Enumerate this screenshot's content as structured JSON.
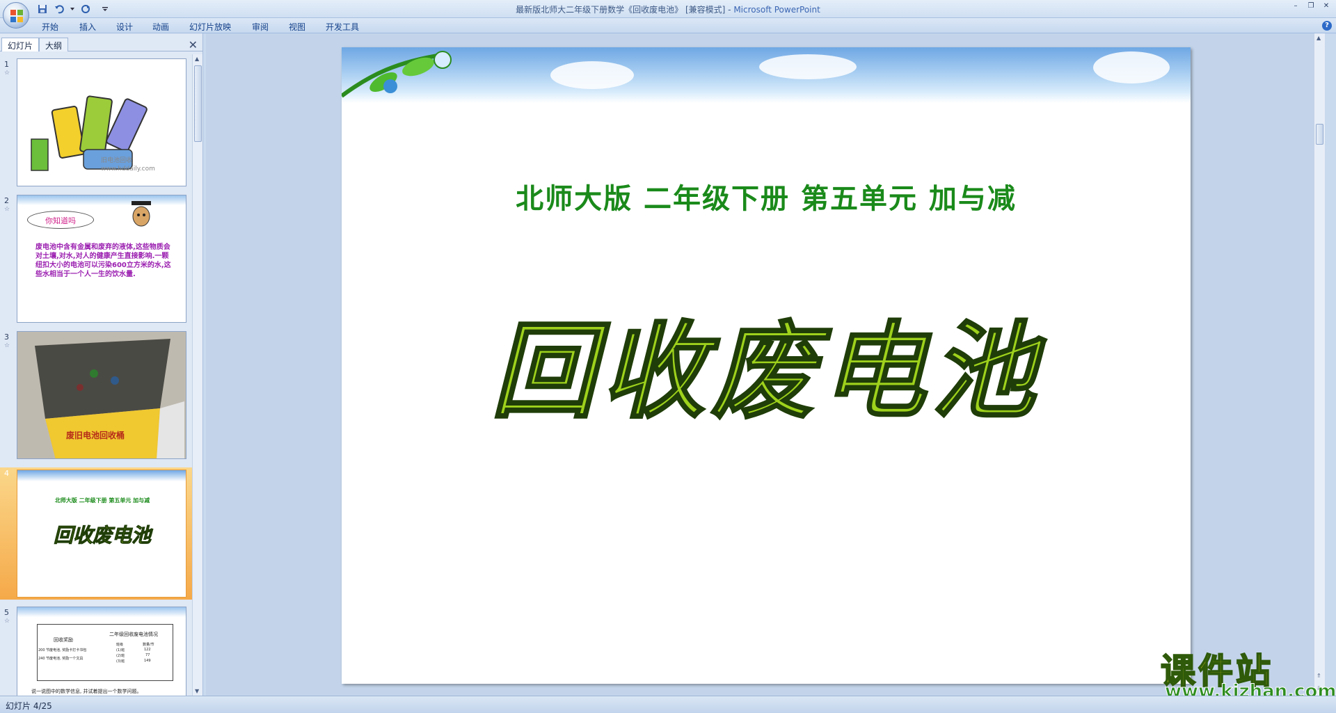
{
  "window": {
    "title": "最新版北师大二年级下册数学《回收废电池》 [兼容模式] - ",
    "app_name": "Microsoft PowerPoint"
  },
  "ribbon": {
    "tabs": [
      {
        "label": "开始"
      },
      {
        "label": "插入"
      },
      {
        "label": "设计"
      },
      {
        "label": "动画"
      },
      {
        "label": "幻灯片放映"
      },
      {
        "label": "审阅"
      },
      {
        "label": "视图"
      },
      {
        "label": "开发工具"
      }
    ]
  },
  "left_pane": {
    "tabs": [
      {
        "label": "幻灯片"
      },
      {
        "label": "大纲"
      }
    ],
    "slides": [
      {
        "number": "1",
        "text": "旧电池回收 www.hddaily.com"
      },
      {
        "number": "2",
        "bubble": "你知道吗",
        "text": "废电池中含有金属和废弃的液体,这些物质会对土壤,对水,对人的健康产生直接影响.一颗纽扣大小的电池可以污染600立方米的水,这些水相当于一个人一生的饮水量."
      },
      {
        "number": "3",
        "text": "废旧电池回收桶"
      },
      {
        "number": "4",
        "subtitle": "北师大版 二年级下册 第五单元 加与减",
        "title": "回收废电池"
      },
      {
        "number": "5",
        "table_title_left": "回收奖励",
        "table_title_right": "二年级回收废电池情况",
        "row1": "200 节废电池, 奖励卡打卡书包",
        "row2": "240 节废电池, 奖励一个文具",
        "hdr1": "班级",
        "hdr2": "数量/节",
        "c1": "(1)班",
        "v1": "122",
        "c2": "(2)班",
        "v2": "77",
        "c3": "(3)班",
        "v3": "149",
        "footer": "说一说图中的数学信息, 并试着提出一个数学问题。"
      }
    ]
  },
  "slide": {
    "subtitle": "北师大版  二年级下册  第五单元  加与减",
    "title": "回收废电池"
  },
  "watermark": {
    "main": "课件站",
    "url": "www.kjzhan.com"
  },
  "status": {
    "slide_counter": "幻灯片 4/25"
  }
}
